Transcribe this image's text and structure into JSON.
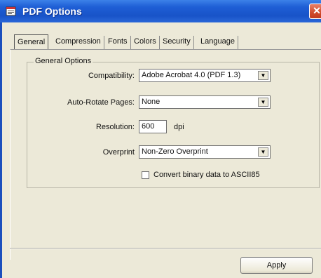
{
  "window": {
    "title": "PDF Options",
    "close_glyph": "✕"
  },
  "tabs": [
    {
      "label": "General",
      "active": true
    },
    {
      "label": "Compression"
    },
    {
      "label": "Fonts"
    },
    {
      "label": "Colors"
    },
    {
      "label": "Security"
    },
    {
      "label": "Language"
    }
  ],
  "general_options": {
    "legend": "General Options",
    "compatibility": {
      "label": "Compatibility:",
      "value": "Adobe Acrobat 4.0 (PDF 1.3)"
    },
    "auto_rotate": {
      "label": "Auto-Rotate Pages:",
      "value": "None"
    },
    "resolution": {
      "label": "Resolution:",
      "value": "600",
      "unit": "dpi"
    },
    "overprint": {
      "label": "Overprint",
      "value": "Non-Zero Overprint"
    },
    "ascii85": {
      "label": "Convert binary data to ASCII85",
      "checked": false
    }
  },
  "buttons": {
    "apply": "Apply"
  },
  "icons": {
    "title_icon": "pdf-document-icon",
    "dropdown": "chevron-down-icon"
  },
  "colors": {
    "titlebar": "#1853c8",
    "dialog_bg": "#ece9d8",
    "close_button": "#d04a2c"
  }
}
